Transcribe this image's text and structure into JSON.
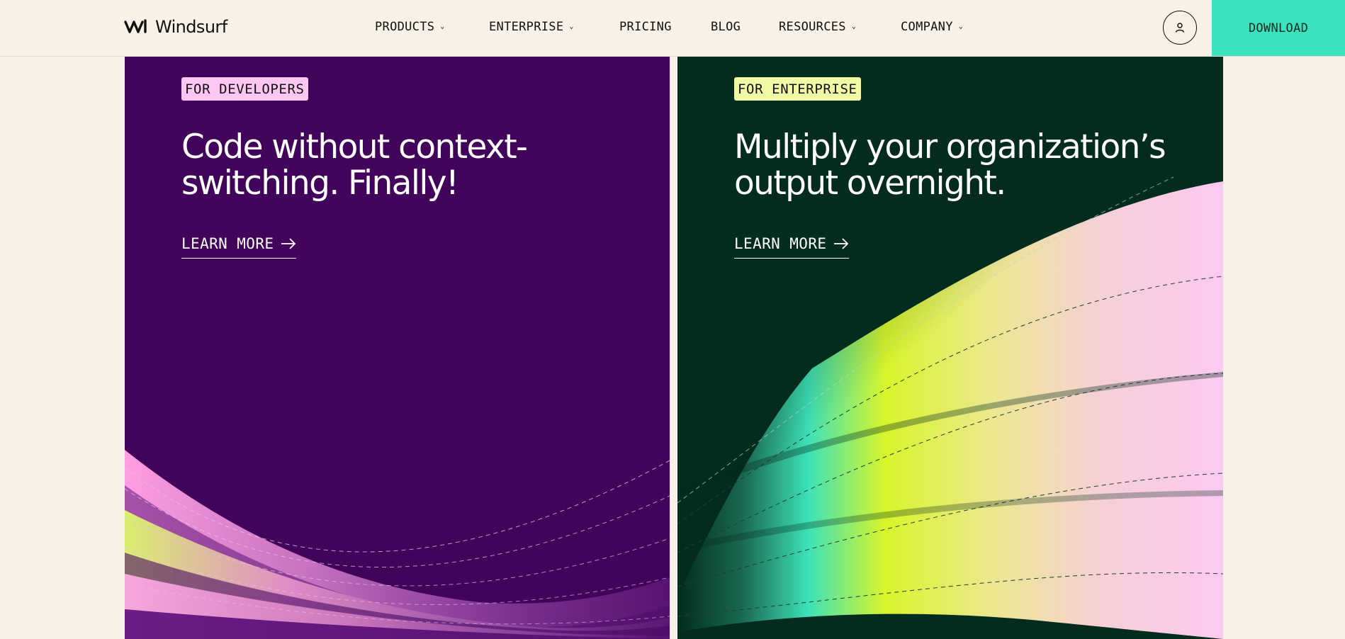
{
  "header": {
    "logo_text": "Windsurf",
    "logo_icon": "windsurf-wave-logo",
    "nav": [
      {
        "label": "PRODUCTS",
        "has_dropdown": true
      },
      {
        "label": "ENTERPRISE",
        "has_dropdown": true
      },
      {
        "label": "PRICING",
        "has_dropdown": false
      },
      {
        "label": "BLOG",
        "has_dropdown": false
      },
      {
        "label": "RESOURCES",
        "has_dropdown": true
      },
      {
        "label": "COMPANY",
        "has_dropdown": true
      }
    ],
    "chevron_glyph": "⌄",
    "account_icon": "user-icon",
    "download_label": "DOWNLOAD"
  },
  "cards": {
    "developers": {
      "badge": "FOR DEVELOPERS",
      "headline_line1": "Code without context-",
      "headline_line2": "switching. Finally!",
      "cta": "LEARN MORE",
      "cta_icon": "arrow-right-icon"
    },
    "enterprise": {
      "badge": "FOR ENTERPRISE",
      "headline_line1": "Multiply your organization’s",
      "headline_line2": "output overnight.",
      "cta": "LEARN MORE",
      "cta_icon": "arrow-right-icon"
    }
  },
  "colors": {
    "page_background": "#f8f1e7",
    "download_accent": "#3ae2be",
    "developers_card": "#42045a",
    "enterprise_card": "#032c1f",
    "developers_badge": "#fdc6f3",
    "enterprise_badge": "#f2f9a5"
  }
}
